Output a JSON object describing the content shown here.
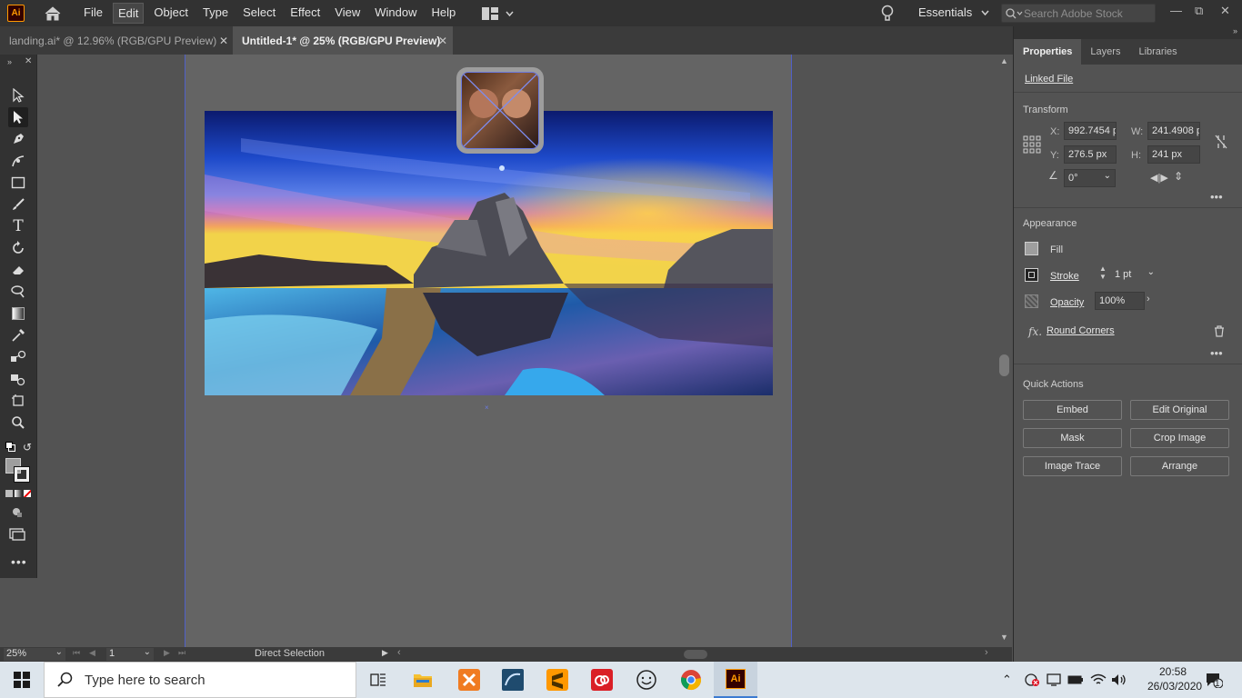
{
  "app": {
    "logo_text": "Ai",
    "accent": "#ff9a00"
  },
  "menu": [
    "File",
    "Edit",
    "Object",
    "Type",
    "Select",
    "Effect",
    "View",
    "Window",
    "Help"
  ],
  "workspace": {
    "label": "Essentials"
  },
  "stock_search": {
    "placeholder": "Search Adobe Stock"
  },
  "tabs": [
    {
      "label": "landing.ai* @ 12.96% (RGB/GPU Preview)",
      "active": false
    },
    {
      "label": "Untitled-1* @ 25% (RGB/GPU Preview)",
      "active": true
    }
  ],
  "status": {
    "zoom": "25%",
    "page": "1",
    "tool": "Direct Selection"
  },
  "panel": {
    "tabs": [
      "Properties",
      "Layers",
      "Libraries"
    ],
    "linked_file": "Linked File",
    "transform": {
      "title": "Transform",
      "x_label": "X:",
      "x": "992.7454 p",
      "y_label": "Y:",
      "y": "276.5 px",
      "w_label": "W:",
      "w": "241.4908 p",
      "h_label": "H:",
      "h": "241 px",
      "angle": "0°"
    },
    "appearance": {
      "title": "Appearance",
      "fill": "Fill",
      "stroke": "Stroke",
      "stroke_value": "1 pt",
      "opacity": "Opacity",
      "opacity_value": "100%",
      "fx": "fx.",
      "round_corners": "Round Corners"
    },
    "quick_actions": {
      "title": "Quick Actions",
      "buttons": [
        "Embed",
        "Edit Original",
        "Mask",
        "Crop Image",
        "Image Trace",
        "Arrange"
      ]
    }
  },
  "taskbar": {
    "search_placeholder": "Type here to search",
    "time": "20:58",
    "date": "26/03/2020",
    "notification_count": "1"
  }
}
